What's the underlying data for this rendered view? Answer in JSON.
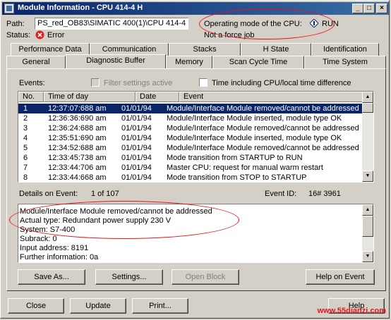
{
  "window": {
    "title": "Module Information - CPU 414-4 H",
    "minimize": "_",
    "maximize": "□",
    "close": "×"
  },
  "info": {
    "path_label": "Path:",
    "path_value": "PS_red_OB83\\SIMATIC 400(1)\\CPU 414-4 H",
    "mode_label": "Operating mode of the  CPU:",
    "mode_value": "RUN",
    "status_label": "Status:",
    "status_value": "Error",
    "force_status": "Not a force job"
  },
  "tabs_row1": [
    "Performance Data",
    "Communication",
    "Stacks",
    "H State",
    "Identification"
  ],
  "tabs_row2": [
    "General",
    "Diagnostic Buffer",
    "Memory",
    "Scan Cycle Time",
    "Time System"
  ],
  "events": {
    "label": "Events:",
    "filter_label": "Filter settings active",
    "time_checkbox_label": "Time including CPU/local time difference",
    "columns": [
      "No.",
      "Time of day",
      "Date",
      "Event"
    ],
    "rows": [
      {
        "no": "1",
        "time": "12:37:07:688 am",
        "date": "01/01/94",
        "event": "Module/Interface Module  removed/cannot be addressed"
      },
      {
        "no": "2",
        "time": "12:36:36:690 am",
        "date": "01/01/94",
        "event": "Module/Interface Module  inserted, module type OK"
      },
      {
        "no": "3",
        "time": "12:36:24:688 am",
        "date": "01/01/94",
        "event": "Module/Interface Module  removed/cannot be addressed"
      },
      {
        "no": "4",
        "time": "12:35:51:690 am",
        "date": "01/01/94",
        "event": "Module/Interface Module  inserted, module type OK"
      },
      {
        "no": "5",
        "time": "12:34:52:688 am",
        "date": "01/01/94",
        "event": "Module/Interface Module  removed/cannot be addressed"
      },
      {
        "no": "6",
        "time": "12:33:45:738 am",
        "date": "01/01/94",
        "event": "Mode transition from STARTUP to RUN"
      },
      {
        "no": "7",
        "time": "12:33:44:706 am",
        "date": "01/01/94",
        "event": "Master CPU: request for manual warm restart"
      },
      {
        "no": "8",
        "time": "12:33:44:668 am",
        "date": "01/01/94",
        "event": "Mode transition from STOP to STARTUP"
      }
    ]
  },
  "details": {
    "label": "Details on Event:",
    "position": "1 of 107",
    "event_id_label": "Event ID:",
    "event_id_value": "16# 3961",
    "lines": [
      "Module/Interface Module  removed/cannot be addressed",
      "Actual type: Redundant power supply 230 V",
      "System: S7-400",
      "Subrack:    0",
      "Input address:  8191",
      "Further information: 0a"
    ]
  },
  "buttons": {
    "save_as": "Save As...",
    "settings": "Settings...",
    "open_block": "Open Block",
    "help_on_event": "Help on Event",
    "close": "Close",
    "update": "Update",
    "print": "Print...",
    "help": "Help"
  },
  "watermark": "www.55dianzi.com",
  "colors": {
    "title_bar": "#0a246a",
    "selection": "#0a246a",
    "annotation": "#e8141c",
    "error_icon": "#e0201e"
  }
}
